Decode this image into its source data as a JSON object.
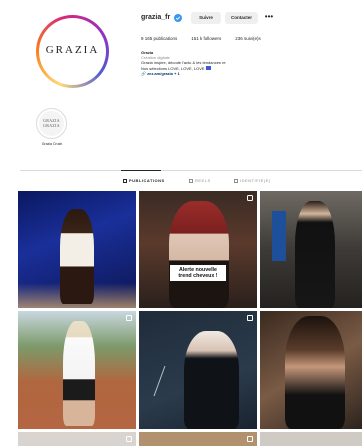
{
  "profile": {
    "username": "grazia_fr",
    "avatar_logo_text": "GRAZIA",
    "follow_label": "Suivre",
    "contact_label": "Contacter",
    "more_label": "•••",
    "stats": {
      "posts": "9 165 publications",
      "followers": "151 k followers",
      "following": "236 suivi(e)s"
    },
    "bio": {
      "name": "Grazia",
      "category": "Création digitale",
      "line1": "Grazia inspire, décode l'actu & les tendances re",
      "line2": "Nos sélections LOVE, LOVE, LOVE",
      "link": "🔗 zez.am/grazia + 1"
    }
  },
  "highlights": [
    {
      "label": "Grazia Crush",
      "cover_text": "GRAZIA GRAZIA"
    }
  ],
  "tabs": [
    {
      "label": "PUBLICATIONS",
      "active": true
    },
    {
      "label": "REELS",
      "active": false
    },
    {
      "label": "IDENTIFIÉ(E)",
      "active": false
    }
  ],
  "grid": {
    "posts": [
      {
        "icon": "none"
      },
      {
        "icon": "reel-icon",
        "overlay_text": "Alerte nouvelle trend cheveux !"
      },
      {
        "icon": "none"
      },
      {
        "icon": "carousel-icon"
      },
      {
        "icon": "carousel-icon"
      },
      {
        "icon": "none"
      },
      {
        "icon": "reel-icon"
      },
      {
        "icon": "carousel-icon"
      },
      {
        "icon": "none"
      }
    ]
  },
  "colors": {
    "verified": "#3897f0",
    "link": "#00376b",
    "button_bg": "#efefef"
  }
}
